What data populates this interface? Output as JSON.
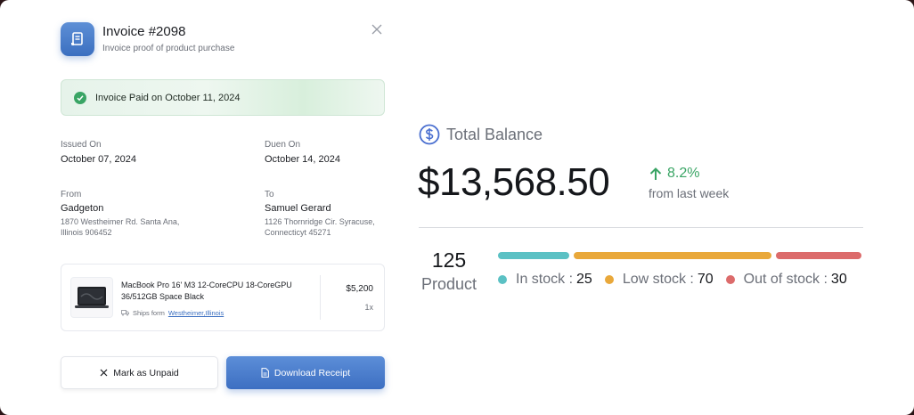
{
  "invoice": {
    "title": "Invoice #2098",
    "subtitle": "Invoice proof of product purchase",
    "paid_banner": "Invoice Paid on October 11, 2024",
    "issued_label": "Issued On",
    "issued_value": "October  07, 2024",
    "due_label": "Duen On",
    "due_value": "October  14, 2024",
    "from_label": "From",
    "from_name": "Gadgeton",
    "from_address": "1870 Westheimer Rd. Santa Ana, Illinois 906452",
    "to_label": "To",
    "to_name": "Samuel Gerard",
    "to_address": "1126 Thornridge Cir. Syracuse, Connecticyt 45271",
    "product": {
      "name": "MacBook Pro 16' M3 12-CoreCPU 18-CoreGPU 36/512GB Space Black",
      "ships_prefix": "Ships form",
      "ships_location": "Westheimer,Illinois",
      "price": "$5,200",
      "quantity": "1x"
    },
    "mark_unpaid_label": "Mark as Unpaid",
    "download_label": "Download Receipt"
  },
  "balance": {
    "title": "Total Balance",
    "amount": "$13,568.50",
    "change": "8.2%",
    "period": "from last week",
    "product_count": "125",
    "product_label": "Product",
    "stock": [
      {
        "label": "In stock",
        "value": "25",
        "count": 25,
        "color": "#5bc1c4"
      },
      {
        "label": "Low stock",
        "value": "70",
        "count": 70,
        "color": "#e9a83a"
      },
      {
        "label": "Out of stock",
        "value": "30",
        "count": 30,
        "color": "#dc6b6b"
      }
    ]
  },
  "colors": {
    "accent": "#3d6fc2",
    "success": "#3aa565"
  }
}
